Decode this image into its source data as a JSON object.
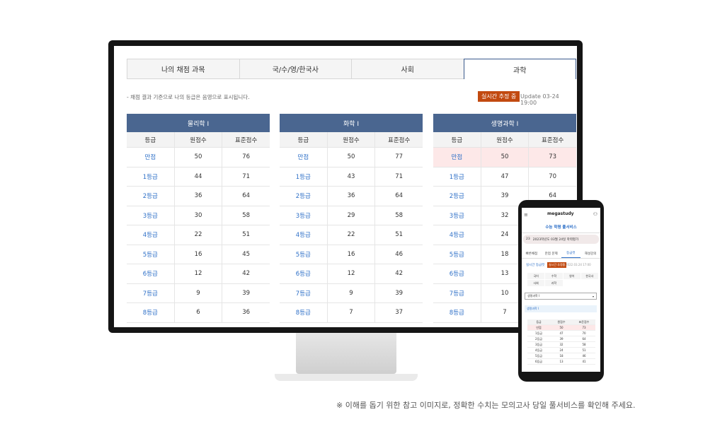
{
  "tabs": [
    "나의 채점 과목",
    "국/수/영/한국사",
    "사회",
    "과학"
  ],
  "notice": "- 채점 결과 기준으로 나의 등급은 음영으로 표시됩니다.",
  "live_badge": "실시간 추정 중",
  "update": "Update 03-24 19:00",
  "col_headers": [
    "등급",
    "원점수",
    "표준점수"
  ],
  "tables": [
    {
      "title": "물리학 I",
      "rows": [
        [
          "만점",
          "50",
          "76"
        ],
        [
          "1등급",
          "44",
          "71"
        ],
        [
          "2등급",
          "36",
          "64"
        ],
        [
          "3등급",
          "30",
          "58"
        ],
        [
          "4등급",
          "22",
          "51"
        ],
        [
          "5등급",
          "16",
          "45"
        ],
        [
          "6등급",
          "12",
          "42"
        ],
        [
          "7등급",
          "9",
          "39"
        ],
        [
          "8등급",
          "6",
          "36"
        ]
      ]
    },
    {
      "title": "화학 I",
      "rows": [
        [
          "만점",
          "50",
          "77"
        ],
        [
          "1등급",
          "43",
          "71"
        ],
        [
          "2등급",
          "36",
          "64"
        ],
        [
          "3등급",
          "29",
          "58"
        ],
        [
          "4등급",
          "22",
          "51"
        ],
        [
          "5등급",
          "16",
          "46"
        ],
        [
          "6등급",
          "12",
          "42"
        ],
        [
          "7등급",
          "9",
          "39"
        ],
        [
          "8등급",
          "7",
          "37"
        ]
      ]
    },
    {
      "title": "생명과학 I",
      "rows": [
        [
          "만점",
          "50",
          "73"
        ],
        [
          "1등급",
          "47",
          "70"
        ],
        [
          "2등급",
          "39",
          "64"
        ],
        [
          "3등급",
          "32",
          ""
        ],
        [
          "4등급",
          "24",
          ""
        ],
        [
          "5등급",
          "18",
          ""
        ],
        [
          "6등급",
          "13",
          ""
        ],
        [
          "7등급",
          "10",
          ""
        ],
        [
          "8등급",
          "7",
          ""
        ]
      ]
    }
  ],
  "phone": {
    "logo": "megastudy",
    "title": "수능 학평 풀서비스",
    "selector": "2023학년도 03월 24일 학력평가",
    "selector_num": "23",
    "nav": [
      "빠른채점",
      "만점 문제",
      "등급컷",
      "해설강의"
    ],
    "live": "실시간 등급컷",
    "badge": "실시간 추정중",
    "date": "2022.03.24 17:00",
    "subjects": [
      "국어",
      "수학",
      "영어",
      "한국사",
      "사회",
      "과학",
      "",
      ""
    ],
    "dropdown": "생명과학 I",
    "sub_label": "생명과학 I",
    "table_headers": [
      "등급",
      "원점수",
      "표준점수"
    ],
    "table_rows": [
      [
        "만점",
        "50",
        "73"
      ],
      [
        "1등급",
        "47",
        "70"
      ],
      [
        "2등급",
        "39",
        "64"
      ],
      [
        "3등급",
        "32",
        "58"
      ],
      [
        "4등급",
        "24",
        "51"
      ],
      [
        "5등급",
        "18",
        "46"
      ],
      [
        "6등급",
        "13",
        "41"
      ]
    ]
  },
  "footnote": "※ 이해를 돕기 위한 참고 이미지로, 정확한 수치는 모의고사 당일 풀서비스를 확인해 주세요."
}
